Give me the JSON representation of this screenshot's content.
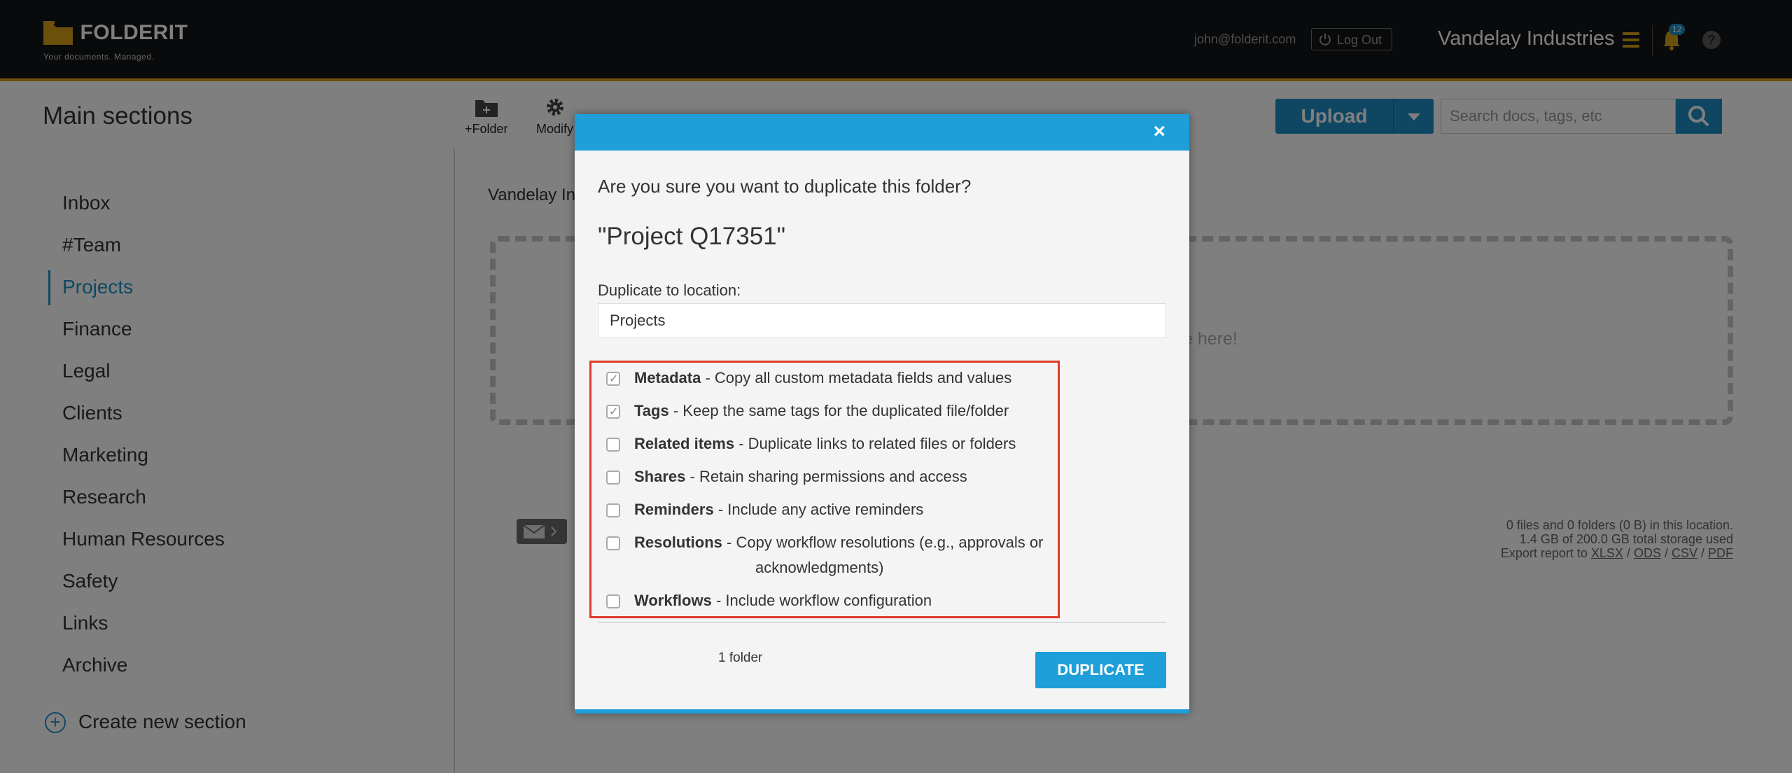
{
  "app": {
    "brand": "FOLDERIT",
    "tagline": "Your documents. Managed.",
    "user_email": "john@folderit.com",
    "logout_label": "Log Out",
    "company": "Vandelay Industries",
    "notification_count": "12",
    "help_label": "?"
  },
  "page": {
    "title": "Main sections",
    "toolbar": [
      {
        "label": "+Folder",
        "icon": "folder-plus-icon"
      },
      {
        "label": "Modify",
        "icon": "gear-icon"
      }
    ],
    "upload_label": "Upload",
    "search_placeholder": "Search docs, tags, etc",
    "breadcrumb": "Vandelay In",
    "drop_text": "e here!",
    "stats": {
      "line1": "0 files and 0 folders (0 B) in this location.",
      "line2": "1.4 GB of 200.0 GB total storage used",
      "export_label": "Export report to",
      "formats": [
        "XLSX",
        "ODS",
        "CSV",
        "PDF"
      ]
    }
  },
  "sidebar": {
    "items": [
      "Inbox",
      "#Team",
      "Projects",
      "Finance",
      "Legal",
      "Clients",
      "Marketing",
      "Research",
      "Human Resources",
      "Safety",
      "Links",
      "Archive"
    ],
    "active": "Projects",
    "create_label": "Create new section"
  },
  "modal": {
    "close": "×",
    "question": "Are you sure you want to duplicate this folder?",
    "folder_name": "\"Project Q17351\"",
    "location_label": "Duplicate to location:",
    "location_value": "Projects",
    "options": [
      {
        "name": "Metadata",
        "desc": "- Copy all custom metadata fields and values",
        "checked": true
      },
      {
        "name": "Tags",
        "desc": "- Keep the same tags for the duplicated file/folder",
        "checked": true
      },
      {
        "name": "Related items",
        "desc": "- Duplicate links to related files or folders",
        "checked": false
      },
      {
        "name": "Shares",
        "desc": "- Retain sharing permissions and access",
        "checked": false
      },
      {
        "name": "Reminders",
        "desc": "- Include any active reminders",
        "checked": false
      },
      {
        "name": "Resolutions",
        "desc": "- Copy workflow resolutions (e.g., approvals or",
        "desc_cont": "acknowledgments)",
        "checked": false
      },
      {
        "name": "Workflows",
        "desc": "- Include workflow configuration",
        "checked": false
      }
    ],
    "count": "1 folder",
    "action_label": "DUPLICATE"
  },
  "colors": {
    "accent": "#1e9fd9",
    "brand_gold": "#d4a017",
    "highlight": "#e23a26"
  }
}
